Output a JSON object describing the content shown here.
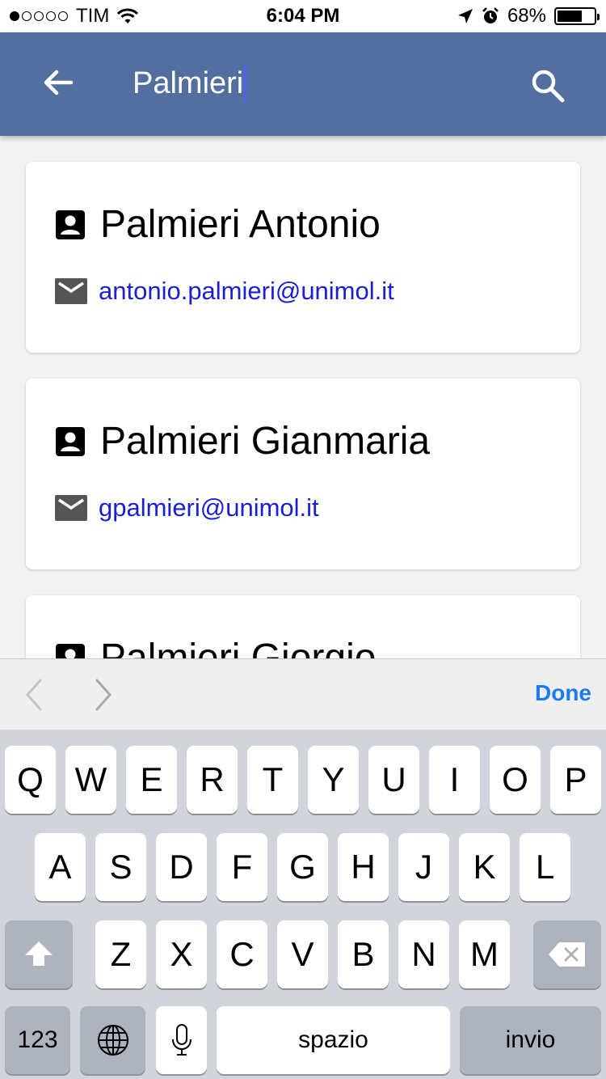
{
  "status_bar": {
    "carrier": "TIM",
    "time": "6:04 PM",
    "battery": "68%",
    "battery_level": 0.68,
    "signal_bars_filled": 1,
    "signal_bars_total": 5
  },
  "app_bar": {
    "search_value": "Palmieri",
    "back_icon": "arrow-left-icon",
    "search_icon": "search-icon",
    "background": "#526f9f"
  },
  "results": [
    {
      "name": "Palmieri Antonio",
      "email": "antonio.palmieri@unimol.it"
    },
    {
      "name": "Palmieri Gianmaria",
      "email": "gpalmieri@unimol.it"
    },
    {
      "name": "Palmieri Giorgio",
      "email": ""
    }
  ],
  "accessory_bar": {
    "done_label": "Done"
  },
  "keyboard": {
    "row1": [
      "Q",
      "W",
      "E",
      "R",
      "T",
      "Y",
      "U",
      "I",
      "O",
      "P"
    ],
    "row2": [
      "A",
      "S",
      "D",
      "F",
      "G",
      "H",
      "J",
      "K",
      "L"
    ],
    "row3": [
      "Z",
      "X",
      "C",
      "V",
      "B",
      "N",
      "M"
    ],
    "numbers_label": "123",
    "space_label": "spazio",
    "return_label": "invio"
  },
  "colors": {
    "link": "#1a1fd4",
    "done": "#1a7cf2"
  }
}
